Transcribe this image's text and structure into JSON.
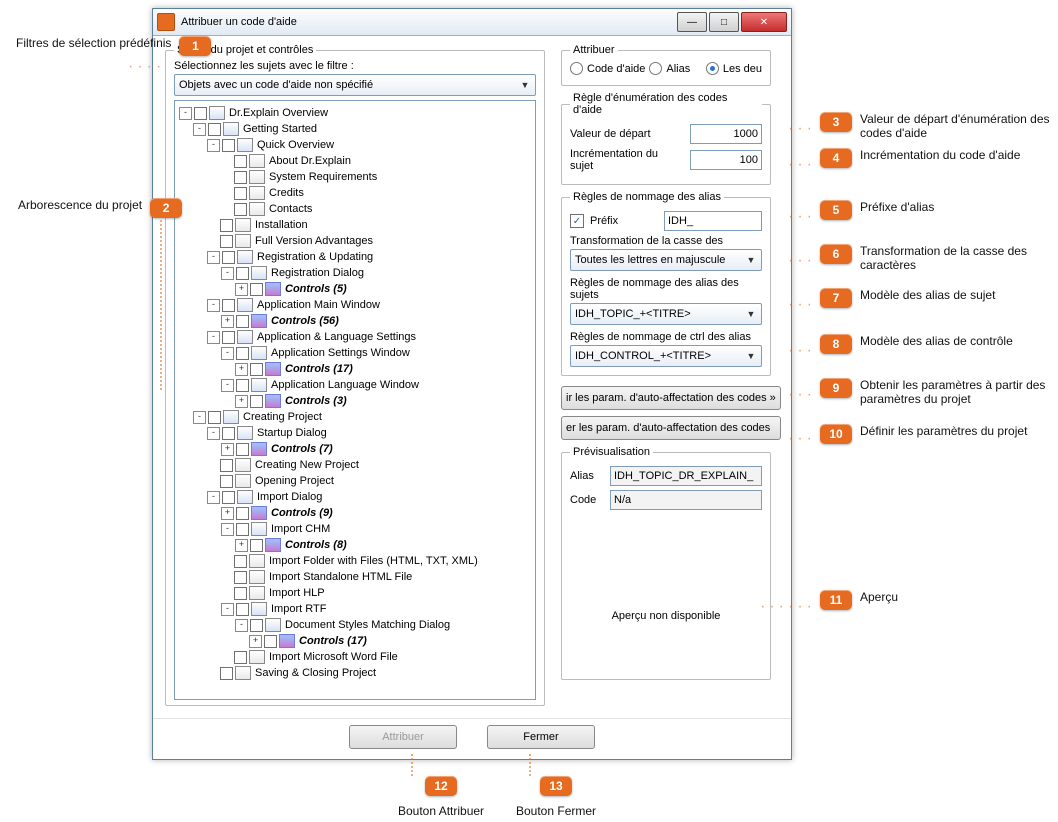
{
  "window": {
    "title": "Attribuer un code d'aide",
    "min": "—",
    "max": "□",
    "close": "✕"
  },
  "left": {
    "group_title": "Sujets du projet et contrôles",
    "select_label": "Sélectionnez les sujets avec le filtre :",
    "filter_value": "Objets avec un code d'aide non spécifié"
  },
  "tree": [
    {
      "exp": "-",
      "t": "folder",
      "lbl": "Dr.Explain Overview",
      "children": [
        {
          "exp": "-",
          "t": "folder",
          "lbl": "Getting Started",
          "children": [
            {
              "exp": "-",
              "t": "folder",
              "lbl": "Quick Overview",
              "children": [
                {
                  "exp": "",
                  "t": "doc",
                  "lbl": "About Dr.Explain"
                },
                {
                  "exp": "",
                  "t": "doc",
                  "lbl": "System Requirements"
                },
                {
                  "exp": "",
                  "t": "doc",
                  "lbl": "Credits"
                },
                {
                  "exp": "",
                  "t": "doc",
                  "lbl": "Contacts"
                }
              ]
            },
            {
              "exp": "",
              "t": "doc",
              "lbl": "Installation"
            },
            {
              "exp": "",
              "t": "doc",
              "lbl": "Full Version Advantages"
            },
            {
              "exp": "-",
              "t": "folder",
              "lbl": "Registration & Updating",
              "children": [
                {
                  "exp": "-",
                  "t": "folder",
                  "lbl": "Registration Dialog",
                  "children": [
                    {
                      "exp": "+",
                      "t": "ctrl",
                      "lbl": "Controls (5)",
                      "ctrls": true
                    }
                  ]
                }
              ]
            },
            {
              "exp": "-",
              "t": "folder",
              "lbl": "Application Main Window",
              "children": [
                {
                  "exp": "+",
                  "t": "ctrl",
                  "lbl": "Controls (56)",
                  "ctrls": true
                }
              ]
            },
            {
              "exp": "-",
              "t": "folder",
              "lbl": "Application & Language Settings",
              "children": [
                {
                  "exp": "-",
                  "t": "folder",
                  "lbl": "Application Settings Window",
                  "children": [
                    {
                      "exp": "+",
                      "t": "ctrl",
                      "lbl": "Controls (17)",
                      "ctrls": true
                    }
                  ]
                },
                {
                  "exp": "-",
                  "t": "folder",
                  "lbl": "Application Language Window",
                  "children": [
                    {
                      "exp": "+",
                      "t": "ctrl",
                      "lbl": "Controls (3)",
                      "ctrls": true
                    }
                  ]
                }
              ]
            }
          ]
        },
        {
          "exp": "-",
          "t": "folder",
          "lbl": "Creating Project",
          "children": [
            {
              "exp": "-",
              "t": "folder",
              "lbl": "Startup Dialog",
              "children": [
                {
                  "exp": "+",
                  "t": "ctrl",
                  "lbl": "Controls (7)",
                  "ctrls": true
                }
              ]
            },
            {
              "exp": "",
              "t": "doc",
              "lbl": "Creating New Project"
            },
            {
              "exp": "",
              "t": "doc",
              "lbl": "Opening Project"
            },
            {
              "exp": "-",
              "t": "folder",
              "lbl": "Import Dialog",
              "children": [
                {
                  "exp": "+",
                  "t": "ctrl",
                  "lbl": "Controls (9)",
                  "ctrls": true
                },
                {
                  "exp": "-",
                  "t": "folder",
                  "lbl": "Import CHM",
                  "children": [
                    {
                      "exp": "+",
                      "t": "ctrl",
                      "lbl": "Controls (8)",
                      "ctrls": true
                    }
                  ]
                },
                {
                  "exp": "",
                  "t": "doc",
                  "lbl": "Import Folder with Files (HTML, TXT, XML)"
                },
                {
                  "exp": "",
                  "t": "doc",
                  "lbl": "Import Standalone HTML File"
                },
                {
                  "exp": "",
                  "t": "doc",
                  "lbl": "Import HLP"
                },
                {
                  "exp": "-",
                  "t": "folder",
                  "lbl": "Import RTF",
                  "children": [
                    {
                      "exp": "-",
                      "t": "folder",
                      "lbl": "Document Styles Matching Dialog",
                      "children": [
                        {
                          "exp": "+",
                          "t": "ctrl",
                          "lbl": "Controls (17)",
                          "ctrls": true
                        }
                      ]
                    }
                  ]
                },
                {
                  "exp": "",
                  "t": "doc",
                  "lbl": "Import Microsoft Word File"
                }
              ]
            },
            {
              "exp": "",
              "t": "doc",
              "lbl": "Saving & Closing Project"
            }
          ]
        }
      ]
    }
  ],
  "right": {
    "assign_group": "Attribuer",
    "radio1": "Code d'aide",
    "radio2": "Alias",
    "radio3": "Les deux",
    "radio3_display": "Les deu",
    "enum_group": "Règle d'énumération des codes d'aide",
    "start_label": "Valeur de départ",
    "start_value": "1000",
    "incr_label": "Incrémentation du sujet",
    "incr_value": "100",
    "alias_group": "Règles de nommage des alias",
    "prefix_chk": "Préfixe",
    "prefix_chk_display": "Préfix",
    "prefix_value": "IDH_",
    "case_label": "Transformation de la casse des",
    "case_value": "Toutes les lettres en majuscule",
    "subj_rule_label": "Règles de nommage des alias des sujets",
    "subj_rule_value": "IDH_TOPIC_+<TITRE>",
    "ctrl_rule_label": "Règles de nommage de ctrl des alias",
    "ctrl_rule_value": "IDH_CONTROL_+<TITRE>",
    "btn_get": "ir les param. d'auto-affectation des codes »",
    "btn_set": "er les param. d'auto-affectation des codes",
    "preview_group": "Prévisualisation",
    "alias_k": "Alias",
    "alias_v": "IDH_TOPIC_DR_EXPLAIN_",
    "code_k": "Code",
    "code_v": "N/a",
    "no_preview": "Aperçu non disponible"
  },
  "footer": {
    "assign": "Attribuer",
    "close": "Fermer"
  },
  "callouts": {
    "c1": "Filtres de sélection prédéfinis",
    "c2": "Arborescence du projet",
    "c3": "Valeur de départ d'énumération des codes d'aide",
    "c4": "Incrémentation du code d'aide",
    "c5": "Préfixe d'alias",
    "c6": "Transformation de la casse des caractères",
    "c7": "Modèle des alias de sujet",
    "c8": "Modèle des alias de contrôle",
    "c9": "Obtenir les paramètres à partir des paramètres du projet",
    "c10": "Définir les paramètres du projet",
    "c11": "Aperçu",
    "c12": "Bouton Attribuer",
    "c13": "Bouton Fermer"
  }
}
